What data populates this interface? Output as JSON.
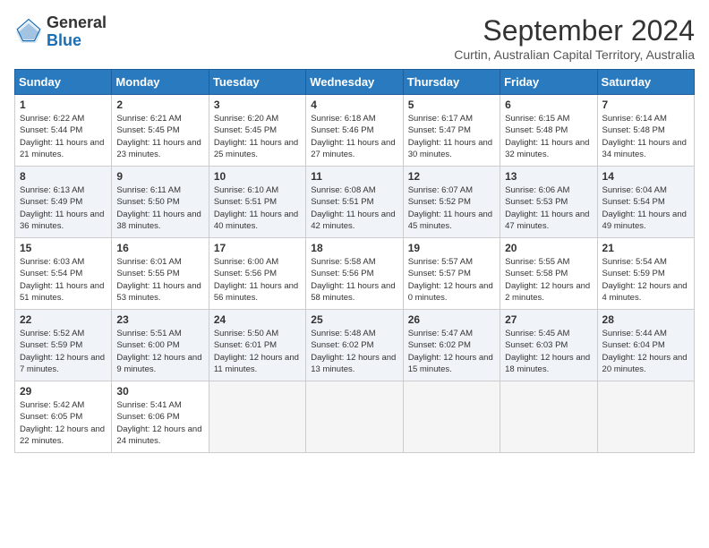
{
  "header": {
    "logo_general": "General",
    "logo_blue": "Blue",
    "month_year": "September 2024",
    "location": "Curtin, Australian Capital Territory, Australia"
  },
  "days_of_week": [
    "Sunday",
    "Monday",
    "Tuesday",
    "Wednesday",
    "Thursday",
    "Friday",
    "Saturday"
  ],
  "weeks": [
    [
      {
        "day": "1",
        "sunrise": "6:22 AM",
        "sunset": "5:44 PM",
        "daylight": "11 hours and 21 minutes."
      },
      {
        "day": "2",
        "sunrise": "6:21 AM",
        "sunset": "5:45 PM",
        "daylight": "11 hours and 23 minutes."
      },
      {
        "day": "3",
        "sunrise": "6:20 AM",
        "sunset": "5:45 PM",
        "daylight": "11 hours and 25 minutes."
      },
      {
        "day": "4",
        "sunrise": "6:18 AM",
        "sunset": "5:46 PM",
        "daylight": "11 hours and 27 minutes."
      },
      {
        "day": "5",
        "sunrise": "6:17 AM",
        "sunset": "5:47 PM",
        "daylight": "11 hours and 30 minutes."
      },
      {
        "day": "6",
        "sunrise": "6:15 AM",
        "sunset": "5:48 PM",
        "daylight": "11 hours and 32 minutes."
      },
      {
        "day": "7",
        "sunrise": "6:14 AM",
        "sunset": "5:48 PM",
        "daylight": "11 hours and 34 minutes."
      }
    ],
    [
      {
        "day": "8",
        "sunrise": "6:13 AM",
        "sunset": "5:49 PM",
        "daylight": "11 hours and 36 minutes."
      },
      {
        "day": "9",
        "sunrise": "6:11 AM",
        "sunset": "5:50 PM",
        "daylight": "11 hours and 38 minutes."
      },
      {
        "day": "10",
        "sunrise": "6:10 AM",
        "sunset": "5:51 PM",
        "daylight": "11 hours and 40 minutes."
      },
      {
        "day": "11",
        "sunrise": "6:08 AM",
        "sunset": "5:51 PM",
        "daylight": "11 hours and 42 minutes."
      },
      {
        "day": "12",
        "sunrise": "6:07 AM",
        "sunset": "5:52 PM",
        "daylight": "11 hours and 45 minutes."
      },
      {
        "day": "13",
        "sunrise": "6:06 AM",
        "sunset": "5:53 PM",
        "daylight": "11 hours and 47 minutes."
      },
      {
        "day": "14",
        "sunrise": "6:04 AM",
        "sunset": "5:54 PM",
        "daylight": "11 hours and 49 minutes."
      }
    ],
    [
      {
        "day": "15",
        "sunrise": "6:03 AM",
        "sunset": "5:54 PM",
        "daylight": "11 hours and 51 minutes."
      },
      {
        "day": "16",
        "sunrise": "6:01 AM",
        "sunset": "5:55 PM",
        "daylight": "11 hours and 53 minutes."
      },
      {
        "day": "17",
        "sunrise": "6:00 AM",
        "sunset": "5:56 PM",
        "daylight": "11 hours and 56 minutes."
      },
      {
        "day": "18",
        "sunrise": "5:58 AM",
        "sunset": "5:56 PM",
        "daylight": "11 hours and 58 minutes."
      },
      {
        "day": "19",
        "sunrise": "5:57 AM",
        "sunset": "5:57 PM",
        "daylight": "12 hours and 0 minutes."
      },
      {
        "day": "20",
        "sunrise": "5:55 AM",
        "sunset": "5:58 PM",
        "daylight": "12 hours and 2 minutes."
      },
      {
        "day": "21",
        "sunrise": "5:54 AM",
        "sunset": "5:59 PM",
        "daylight": "12 hours and 4 minutes."
      }
    ],
    [
      {
        "day": "22",
        "sunrise": "5:52 AM",
        "sunset": "5:59 PM",
        "daylight": "12 hours and 7 minutes."
      },
      {
        "day": "23",
        "sunrise": "5:51 AM",
        "sunset": "6:00 PM",
        "daylight": "12 hours and 9 minutes."
      },
      {
        "day": "24",
        "sunrise": "5:50 AM",
        "sunset": "6:01 PM",
        "daylight": "12 hours and 11 minutes."
      },
      {
        "day": "25",
        "sunrise": "5:48 AM",
        "sunset": "6:02 PM",
        "daylight": "12 hours and 13 minutes."
      },
      {
        "day": "26",
        "sunrise": "5:47 AM",
        "sunset": "6:02 PM",
        "daylight": "12 hours and 15 minutes."
      },
      {
        "day": "27",
        "sunrise": "5:45 AM",
        "sunset": "6:03 PM",
        "daylight": "12 hours and 18 minutes."
      },
      {
        "day": "28",
        "sunrise": "5:44 AM",
        "sunset": "6:04 PM",
        "daylight": "12 hours and 20 minutes."
      }
    ],
    [
      {
        "day": "29",
        "sunrise": "5:42 AM",
        "sunset": "6:05 PM",
        "daylight": "12 hours and 22 minutes."
      },
      {
        "day": "30",
        "sunrise": "5:41 AM",
        "sunset": "6:06 PM",
        "daylight": "12 hours and 24 minutes."
      },
      null,
      null,
      null,
      null,
      null
    ]
  ]
}
